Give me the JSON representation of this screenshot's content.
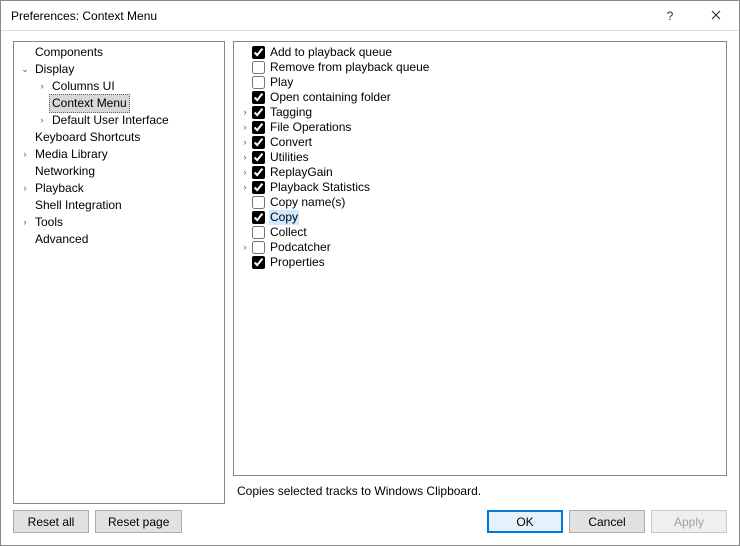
{
  "window": {
    "title": "Preferences: Context Menu"
  },
  "nav": {
    "items": [
      {
        "label": "Components",
        "expandable": false
      },
      {
        "label": "Display",
        "expandable": true,
        "expanded": true,
        "children": [
          {
            "label": "Columns UI",
            "expandable": true,
            "expanded": false
          },
          {
            "label": "Context Menu",
            "expandable": false,
            "selected": true
          },
          {
            "label": "Default User Interface",
            "expandable": true,
            "expanded": false
          }
        ]
      },
      {
        "label": "Keyboard Shortcuts",
        "expandable": false
      },
      {
        "label": "Media Library",
        "expandable": true,
        "expanded": false
      },
      {
        "label": "Networking",
        "expandable": false
      },
      {
        "label": "Playback",
        "expandable": true,
        "expanded": false
      },
      {
        "label": "Shell Integration",
        "expandable": false
      },
      {
        "label": "Tools",
        "expandable": true,
        "expanded": false
      },
      {
        "label": "Advanced",
        "expandable": false
      }
    ]
  },
  "menu": {
    "items": [
      {
        "label": "Add to playback queue",
        "checked": true,
        "expandable": false
      },
      {
        "label": "Remove from playback queue",
        "checked": false,
        "expandable": false
      },
      {
        "label": "Play",
        "checked": false,
        "expandable": false
      },
      {
        "label": "Open containing folder",
        "checked": true,
        "expandable": false
      },
      {
        "label": "Tagging",
        "checked": true,
        "expandable": true
      },
      {
        "label": "File Operations",
        "checked": true,
        "expandable": true
      },
      {
        "label": "Convert",
        "checked": true,
        "expandable": true
      },
      {
        "label": "Utilities",
        "checked": true,
        "expandable": true
      },
      {
        "label": "ReplayGain",
        "checked": true,
        "expandable": true
      },
      {
        "label": "Playback Statistics",
        "checked": true,
        "expandable": true
      },
      {
        "label": "Copy name(s)",
        "checked": false,
        "expandable": false
      },
      {
        "label": "Copy",
        "checked": true,
        "expandable": false,
        "selected": true
      },
      {
        "label": "Collect",
        "checked": false,
        "expandable": false
      },
      {
        "label": "Podcatcher",
        "checked": false,
        "expandable": true
      },
      {
        "label": "Properties",
        "checked": true,
        "expandable": false
      }
    ]
  },
  "hint": "Copies selected tracks to Windows Clipboard.",
  "buttons": {
    "reset_all": "Reset all",
    "reset_page": "Reset page",
    "ok": "OK",
    "cancel": "Cancel",
    "apply": "Apply"
  }
}
